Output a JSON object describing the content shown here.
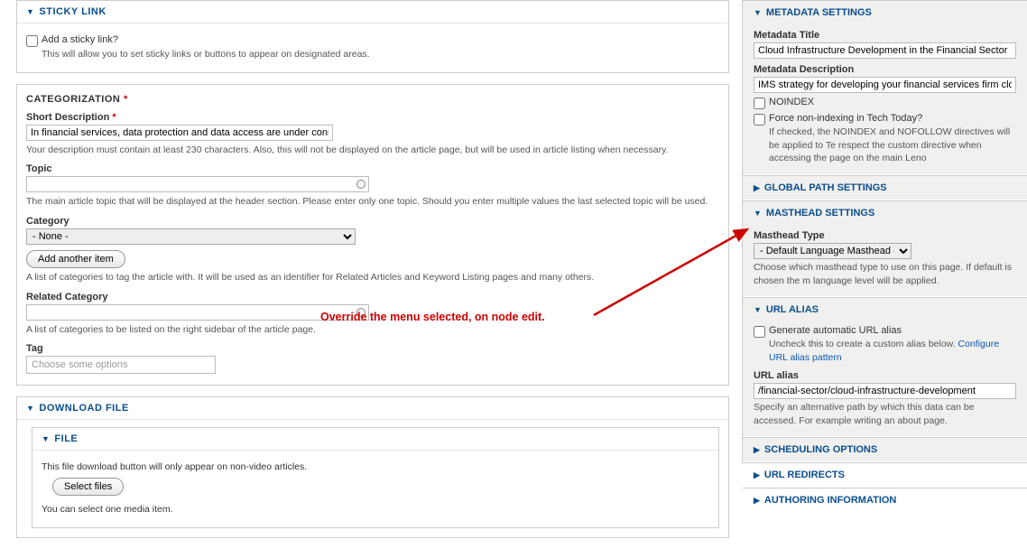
{
  "sticky": {
    "title": "STICKY LINK",
    "checkbox_label": "Add a sticky link?",
    "desc": "This will allow you to set sticky links or buttons to appear on designated areas."
  },
  "categorization": {
    "title": "CATEGORIZATION",
    "short_desc_label": "Short Description",
    "short_desc_value": "In financial services, data protection and data access are under constant scrutin",
    "short_desc_help": "Your description must contain at least 230 characters. Also, this will not be displayed on the article page, but will be used in article listing when necessary.",
    "topic_label": "Topic",
    "topic_help": "The main article topic that will be displayed at the header section. Please enter only one topic. Should you enter multiple values the last selected topic will be used.",
    "category_label": "Category",
    "category_value": "- None -",
    "add_another": "Add another item",
    "category_help": "A list of categories to tag the article with. It will be used as an identifier for Related Articles and Keyword Listing pages and many others.",
    "related_label": "Related Category",
    "related_help": "A list of categories to be listed on the right sidebar of the article page.",
    "tag_label": "Tag",
    "tag_placeholder": "Choose some options"
  },
  "download": {
    "title": "DOWNLOAD FILE",
    "file_title": "FILE",
    "file_desc": "This file download button will only appear on non-video articles.",
    "select_btn": "Select files",
    "select_desc": "You can select one media item."
  },
  "metadata": {
    "title": "METADATA SETTINGS",
    "mtitle_label": "Metadata Title",
    "mtitle_value": "Cloud Infrastructure Development in the Financial Sector",
    "mdesc_label": "Metadata Description",
    "mdesc_value": "IMS strategy for developing your financial services firm cloud infrastru",
    "noindex_label": "NOINDEX",
    "force_label": "Force non-indexing in Tech Today?",
    "force_desc": "If checked, the NOINDEX and NOFOLLOW directives will be applied to Te respect the custom directive when accessing the page on the main Leno"
  },
  "global_path": {
    "title": "GLOBAL PATH SETTINGS"
  },
  "masthead": {
    "title": "MASTHEAD SETTINGS",
    "type_label": "Masthead Type",
    "type_value": "- Default Language Masthead -",
    "type_desc": "Choose which masthead type to use on this page. If default is chosen the m language level will be applied."
  },
  "url_alias": {
    "title": "URL ALIAS",
    "gen_label": "Generate automatic URL alias",
    "gen_desc": "Uncheck this to create a custom alias below. ",
    "gen_link": "Configure URL alias pattern",
    "alias_label": "URL alias",
    "alias_value": "/financial-sector/cloud-infrastructure-development",
    "alias_desc": "Specify an alternative path by which this data can be accessed. For example writing an about page."
  },
  "scheduling": {
    "title": "SCHEDULING OPTIONS"
  },
  "redirects": {
    "title": "URL REDIRECTS"
  },
  "authoring": {
    "title": "AUTHORING INFORMATION"
  },
  "annotation": "Override the menu selected, on node edit."
}
